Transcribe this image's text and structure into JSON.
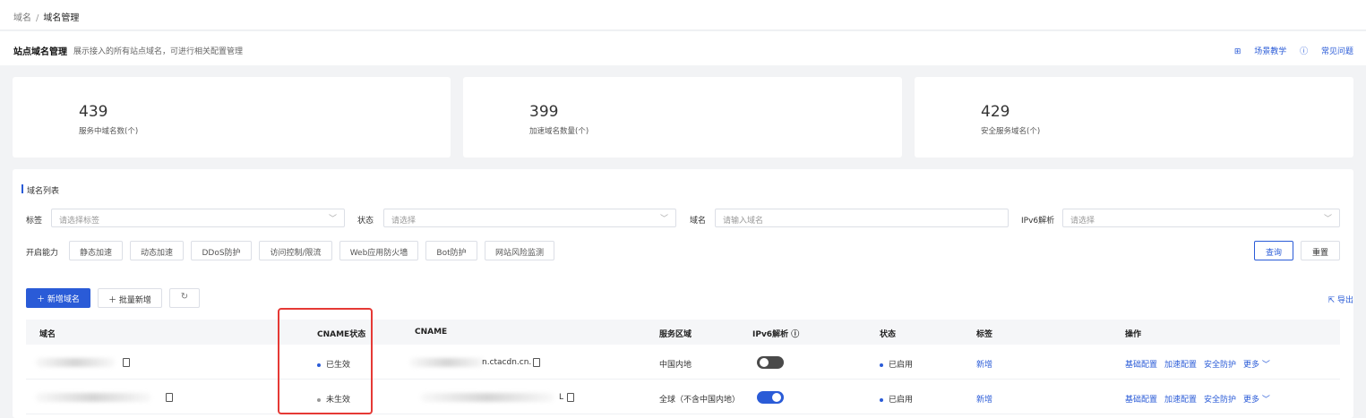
{
  "breadcrumb": {
    "root": "域名",
    "current": "域名管理"
  },
  "header": {
    "title": "站点域名管理",
    "description": "展示接入的所有站点域名，可进行相关配置管理",
    "link_tutorial": "场景教学",
    "link_faq": "常见问题"
  },
  "stats": [
    {
      "value": "439",
      "label": "服务中域名数(个)"
    },
    {
      "value": "399",
      "label": "加速域名数量(个)"
    },
    {
      "value": "429",
      "label": "安全服务域名(个)"
    }
  ],
  "list": {
    "title": "域名列表",
    "filters": {
      "tag_label": "标签",
      "tag_placeholder": "请选择标签",
      "status_label": "状态",
      "status_placeholder": "请选择",
      "domain_label": "域名",
      "domain_placeholder": "请输入域名",
      "ipv6_label": "IPv6解析",
      "ipv6_placeholder": "请选择"
    },
    "capabilities_label": "开启能力",
    "capabilities": [
      "静态加速",
      "动态加速",
      "DDoS防护",
      "访问控制/限流",
      "Web应用防火墙",
      "Bot防护",
      "网站风险监测"
    ],
    "query": "查询",
    "reset": "重置",
    "add_domain": "＋ 新增域名",
    "batch_add": "＋ 批量新增",
    "export": "导出",
    "columns": [
      "域名",
      "CNAME状态",
      "CNAME",
      "服务区域",
      "IPv6解析 ⓘ",
      "状态",
      "标签",
      "操作"
    ],
    "rows": [
      {
        "cname_status": "已生效",
        "cname_status_color": "#2a5bd7",
        "cname_suffix": "n.ctacdn.cn.",
        "region": "中国内地",
        "ipv6": false,
        "state": "已启用",
        "tag": "新增",
        "ops": [
          "基础配置",
          "加速配置",
          "安全防护",
          "更多 ﹀"
        ]
      },
      {
        "cname_status": "未生效",
        "cname_status_color": "#999999",
        "cname_suffix": "L",
        "region": "全球（不含中国内地）",
        "ipv6": true,
        "state": "已启用",
        "tag": "新增",
        "ops": [
          "基础配置",
          "加速配置",
          "安全防护",
          "更多 ﹀"
        ]
      }
    ]
  }
}
